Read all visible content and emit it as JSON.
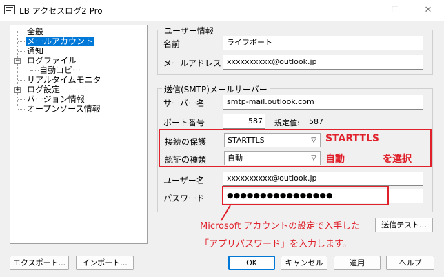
{
  "window": {
    "title": "LB アクセスログ2 Pro",
    "minimize": "—",
    "maximize": "☐",
    "close": "✕"
  },
  "tree": {
    "items": [
      {
        "label": "全般"
      },
      {
        "label": "メールアカウント"
      },
      {
        "label": "通知"
      },
      {
        "label": "ログファイル",
        "expander": "−"
      },
      {
        "label": "自動コピー"
      },
      {
        "label": "リアルタイムモニタ"
      },
      {
        "label": "ログ設定",
        "expander": "+"
      },
      {
        "label": "バージョン情報"
      },
      {
        "label": "オープンソース情報"
      }
    ]
  },
  "user_info": {
    "title": "ユーザー情報",
    "name_label": "名前",
    "name_value": "ライフボート",
    "email_label": "メールアドレス",
    "email_value": "xxxxxxxxxx@outlook.jp"
  },
  "smtp": {
    "title": "送信(SMTP)メールサーバー",
    "server_label": "サーバー名",
    "server_value": "smtp-mail.outlook.com",
    "port_label": "ポート番号",
    "port_value": "587",
    "default_label": "規定値:",
    "default_value": "587",
    "security_label": "接続の保護",
    "security_value": "STARTTLS",
    "auth_label": "認証の種類",
    "auth_value": "自動",
    "username_label": "ユーザー名",
    "username_value": "xxxxxxxxxx@outlook.jp",
    "password_label": "パスワード",
    "password_value": "●●●●●●●●●●●●●●●●",
    "test_button": "送信テスト..."
  },
  "annotations": {
    "starttls": "STARTTLS",
    "auto": "自動",
    "select": "を選択",
    "note_line1": "Microsoft アカウントの設定で入手した",
    "note_line2": "「アプリパスワード」を入力します。"
  },
  "footer": {
    "export": "エクスポート...",
    "import": "インポート...",
    "ok": "OK",
    "cancel": "キャンセル",
    "apply": "適用",
    "help": "ヘルプ"
  },
  "colors": {
    "accent": "#0078d7",
    "annotation": "#e0202a"
  }
}
